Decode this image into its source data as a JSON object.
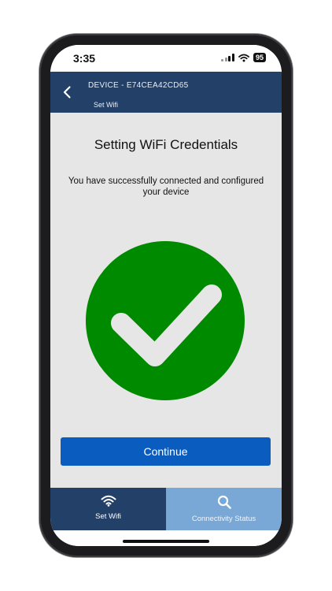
{
  "status_bar": {
    "time": "3:35",
    "battery": "95",
    "icons": [
      "signal-icon",
      "wifi-icon",
      "battery-icon"
    ]
  },
  "header": {
    "device_title": "DEVICE - E74CEA42CD65",
    "subtitle": "Set Wifi",
    "back_icon": "chevron-left-icon"
  },
  "main": {
    "heading": "Setting WiFi Credentials",
    "message": "You have successfully connected and configured your device",
    "success_icon": "checkmark-circle-icon",
    "continue_label": "Continue"
  },
  "tabs": [
    {
      "label": "Set Wifi",
      "icon": "wifi-icon",
      "active": true
    },
    {
      "label": "Connectivity Status",
      "icon": "search-icon",
      "active": false
    }
  ],
  "colors": {
    "header_bg": "#234168",
    "success_green": "#008a00",
    "button_blue": "#0b5cbf",
    "inactive_tab": "#79a8d6",
    "content_bg": "#e6e6e6"
  }
}
